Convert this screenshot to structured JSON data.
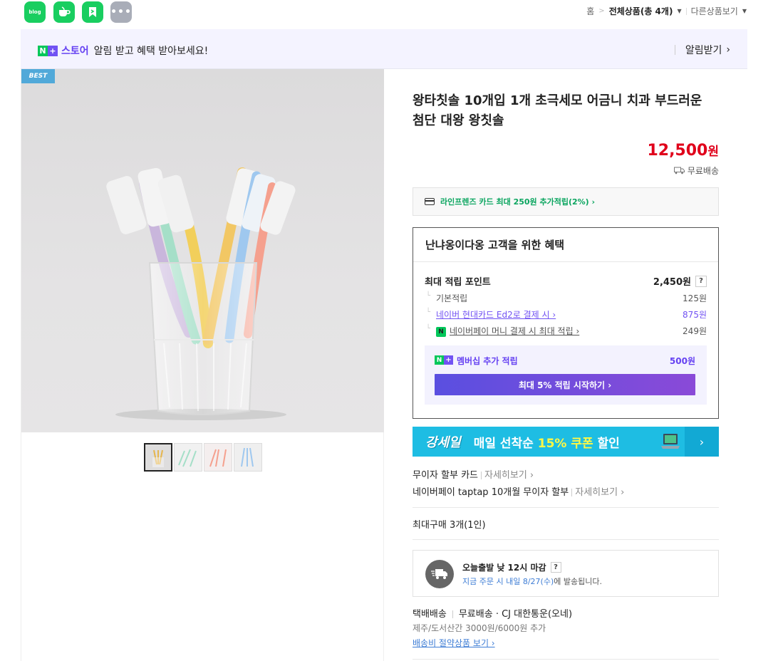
{
  "topbar": {
    "apps": [
      {
        "name": "blog",
        "label": "blog"
      },
      {
        "name": "cafe",
        "label": ""
      },
      {
        "name": "bookmark",
        "label": ""
      },
      {
        "name": "more",
        "label": "•••"
      }
    ],
    "breadcrumb": {
      "home": "홈",
      "category": "전체상품(총 4개)",
      "other": "다른상품보기"
    }
  },
  "banner": {
    "store_label": "스토어",
    "message": "알림 받고 혜택 받아보세요!",
    "alarm_label": "알림받기"
  },
  "gallery": {
    "badge": "BEST",
    "thumb_count": 4
  },
  "product": {
    "title_line1": "왕타칫솔 10개입 1개 초극세모 어금니 치과 부드러운",
    "title_line2": "첨단 대왕 왕칫솔",
    "price": "12,500",
    "price_unit": "원",
    "shipping": "무료배송"
  },
  "card_promo": {
    "text": "라인프렌즈 카드 최대 250원 추가적립(2%) ›"
  },
  "benefit": {
    "heading": "난냐옹이다옹 고객을 위한 혜택",
    "max_points_label": "최대 적립 포인트",
    "max_points_value": "2,450원",
    "rows": [
      {
        "label": "기본적립",
        "value": "125원"
      },
      {
        "label": "네이버 현대카드 Ed2로 결제 시 ›",
        "value": "875원"
      },
      {
        "label": "네이버페이 머니 결제 시 최대 적립 ›",
        "value": "249원"
      }
    ],
    "membership_label": "멤버십 추가 적립",
    "membership_value": "500원",
    "membership_button": "최대 5% 적립 시작하기 ›"
  },
  "sale_banner": {
    "logo": "강세일",
    "text_pre": "매일 선착순 ",
    "text_highlight": "15% 쿠폰",
    "text_post": " 할인",
    "arrow": "›"
  },
  "installments": [
    {
      "label": "무이자 할부 카드",
      "link": "자세히보기 ›"
    },
    {
      "label": "네이버페이 taptap 10개월 무이자 할부",
      "link": "자세히보기 ›"
    }
  ],
  "purchase_limit": "최대구매 3개(1인)",
  "delivery": {
    "title": "오늘출발 낮 12시 마감",
    "help": "?",
    "sub_blue": "지금 주문 시 내일 8/27(수)",
    "sub_rest": "에 발송됩니다."
  },
  "shipping_info": {
    "method": "택배배송",
    "fee": "무료배송 · CJ 대한통운(오네)",
    "extra": "제주/도서산간 3000원/6000원 추가",
    "saving_link": "배송비 절약상품 보기 ›"
  },
  "colors": {
    "accent_red": "#e0001b",
    "naver_green": "#03c75a",
    "naver_purple": "#7152f3",
    "sale_blue": "#1ebde3"
  }
}
